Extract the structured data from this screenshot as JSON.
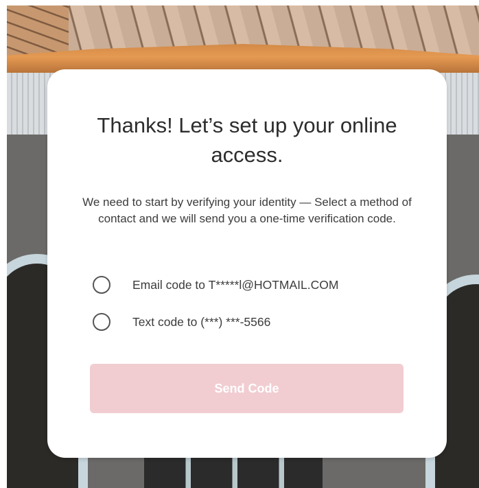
{
  "card": {
    "title": "Thanks! Let’s set up your online access.",
    "description": "We need to start by verifying your identity — Select a method of contact and we will send you a one-time verification code.",
    "options": [
      {
        "label": "Email code to T*****l@HOTMAIL.COM",
        "selected": false
      },
      {
        "label": "Text code to (***) ***-5566",
        "selected": false
      }
    ],
    "send_button": {
      "label": "Send Code",
      "enabled": false
    }
  },
  "colors": {
    "button_disabled_bg": "#f1cdd1",
    "card_bg": "#ffffff",
    "text": "#2d2d2d"
  }
}
